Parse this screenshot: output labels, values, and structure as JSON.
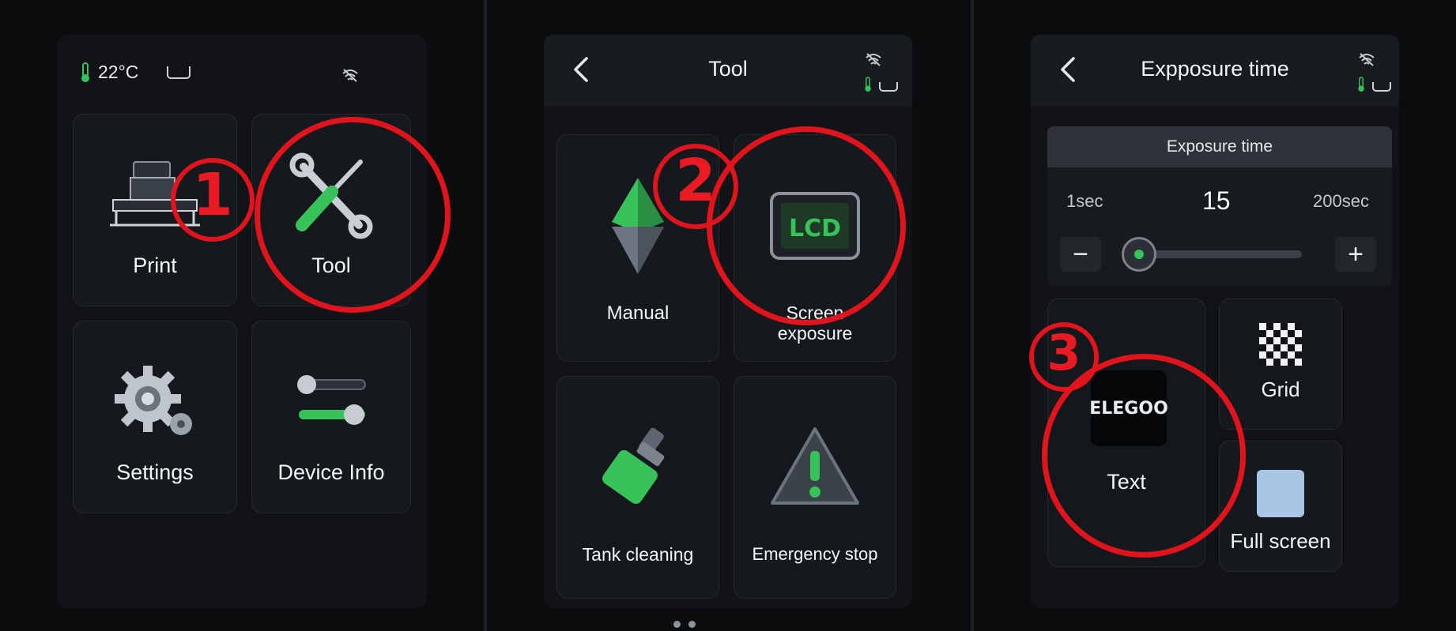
{
  "panel1": {
    "status": {
      "temperature": "22°C"
    },
    "tiles": [
      {
        "label": "Print",
        "icon": "printer-icon"
      },
      {
        "label": "Tool",
        "icon": "wrench-screwdriver-icon"
      },
      {
        "label": "Settings",
        "icon": "gear-icon"
      },
      {
        "label": "Device Info",
        "icon": "sliders-icon"
      }
    ],
    "annotation": "1"
  },
  "panel2": {
    "title": "Tool",
    "tiles": [
      {
        "label": "Manual",
        "icon": "manual-pyramid-icon"
      },
      {
        "label": "Screen\nexposure",
        "icon": "lcd-icon"
      },
      {
        "label": "Tank cleaning",
        "icon": "brush-icon"
      },
      {
        "label": "Emergency stop",
        "icon": "warning-icon"
      }
    ],
    "annotation": "2"
  },
  "panel3": {
    "title": "Expposure time",
    "section_header": "Exposure time",
    "min_label": "1sec",
    "max_label": "200sec",
    "value": "15",
    "value_min": 1,
    "value_max": 200,
    "minus_label": "−",
    "plus_label": "+",
    "tiles": [
      {
        "label": "Text",
        "icon": "elegoo-text-icon",
        "badge": "ELEGOO"
      },
      {
        "label": "Grid",
        "icon": "checker-grid-icon"
      },
      {
        "label": "Full screen",
        "icon": "full-screen-icon"
      }
    ],
    "annotation": "3"
  },
  "page_indicator": {
    "pages": 2
  },
  "colors": {
    "accent_green": "#38c25a",
    "annotation_red": "#e0141c"
  }
}
